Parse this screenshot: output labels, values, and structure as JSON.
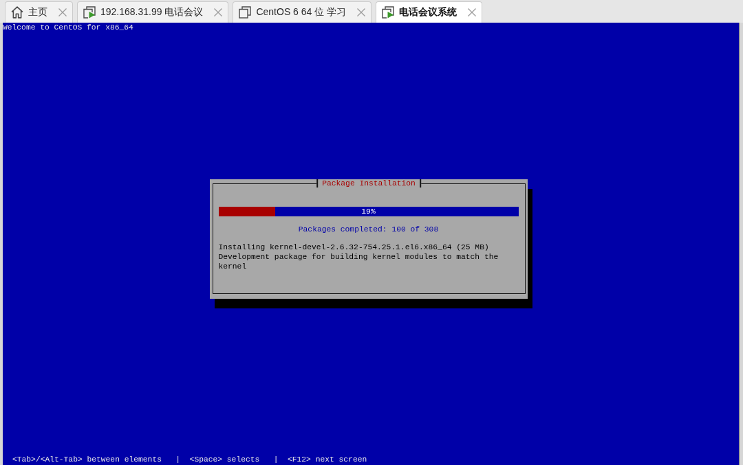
{
  "tabs": [
    {
      "label": "主页",
      "kind": "home",
      "selected": false
    },
    {
      "label": "192.168.31.99 电话会议",
      "kind": "vm-running",
      "selected": false
    },
    {
      "label": "CentOS 6 64 位 学习",
      "kind": "vm",
      "selected": false
    },
    {
      "label": "电话会议系统",
      "kind": "vm-running",
      "selected": true
    }
  ],
  "console": {
    "banner": "Welcome to CentOS for x86_64",
    "dialog": {
      "title": "Package Installation",
      "progress": {
        "level": 0.19,
        "reading": "19%"
      },
      "status": "Packages completed: 100 of 308",
      "details": [
        "Installing kernel-devel-2.6.32-754.25.1.el6.x86_64 (25 MB)",
        "Development package for building kernel modules to match the",
        "kernel"
      ]
    },
    "help_line": "<Tab>/<Alt-Tab> between elements   |  <Space> selects   |  <F12> next screen"
  }
}
